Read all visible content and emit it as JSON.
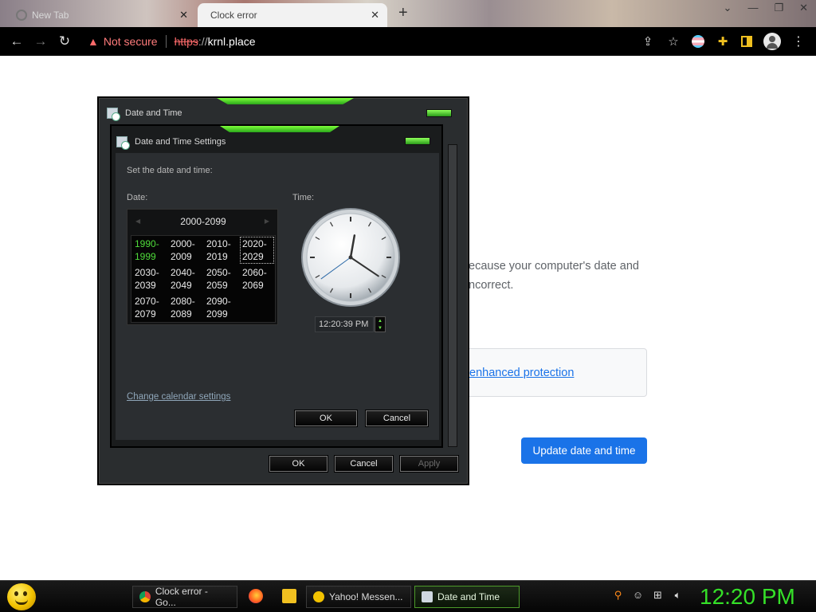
{
  "browser": {
    "tabs": [
      {
        "label": "New Tab",
        "active": false
      },
      {
        "label": "Clock error",
        "active": true
      }
    ],
    "new_tab_symbol": "+",
    "window_controls": {
      "minimize": "⌄",
      "restore": "❐",
      "maximize": "▢",
      "close": "✕"
    },
    "security_label": "Not secure",
    "url_scheme": "https",
    "url_separator": "://",
    "url_host": "krnl.place"
  },
  "page": {
    "error_text_line1": "ecause your computer's date and",
    "error_text_line2": "ncorrect.",
    "enhanced_protection_link": "enhanced protection",
    "update_button": "Update date and time"
  },
  "outer_dialog": {
    "title": "Date and Time",
    "ok": "OK",
    "cancel": "Cancel",
    "apply": "Apply"
  },
  "inner_dialog": {
    "title": "Date and Time Settings",
    "instruction": "Set the date and time:",
    "date_label": "Date:",
    "time_label": "Time:",
    "calendar_header": "2000-2099",
    "decades": [
      {
        "line1": "1990-",
        "line2": "1999",
        "state": "other-century"
      },
      {
        "line1": "2000-",
        "line2": "2009",
        "state": "normal"
      },
      {
        "line1": "2010-",
        "line2": "2019",
        "state": "normal"
      },
      {
        "line1": "2020-",
        "line2": "2029",
        "state": "selected"
      },
      {
        "line1": "2030-",
        "line2": "2039",
        "state": "normal"
      },
      {
        "line1": "2040-",
        "line2": "2049",
        "state": "normal"
      },
      {
        "line1": "2050-",
        "line2": "2059",
        "state": "normal"
      },
      {
        "line1": "2060-",
        "line2": "2069",
        "state": "normal"
      },
      {
        "line1": "2070-",
        "line2": "2079",
        "state": "normal"
      },
      {
        "line1": "2080-",
        "line2": "2089",
        "state": "normal"
      },
      {
        "line1": "2090-",
        "line2": "2099",
        "state": "normal"
      }
    ],
    "time_value": "12:20:39 PM",
    "clock": {
      "hour": 12,
      "minute": 20,
      "second": 39
    },
    "change_calendar_link": "Change calendar settings",
    "ok": "OK",
    "cancel": "Cancel"
  },
  "taskbar": {
    "items": [
      {
        "label": "Clock error - Go...",
        "icon": "chrome-icon"
      },
      {
        "label": "Yahoo! Messen...",
        "icon": "yahoo-messenger-icon"
      },
      {
        "label": "Date and Time",
        "icon": "date-time-icon"
      }
    ],
    "clock": "12:20 PM"
  },
  "colors": {
    "accent_green": "#35e028",
    "link_blue": "#1a73e8",
    "warning_red": "#ff6b6b"
  }
}
